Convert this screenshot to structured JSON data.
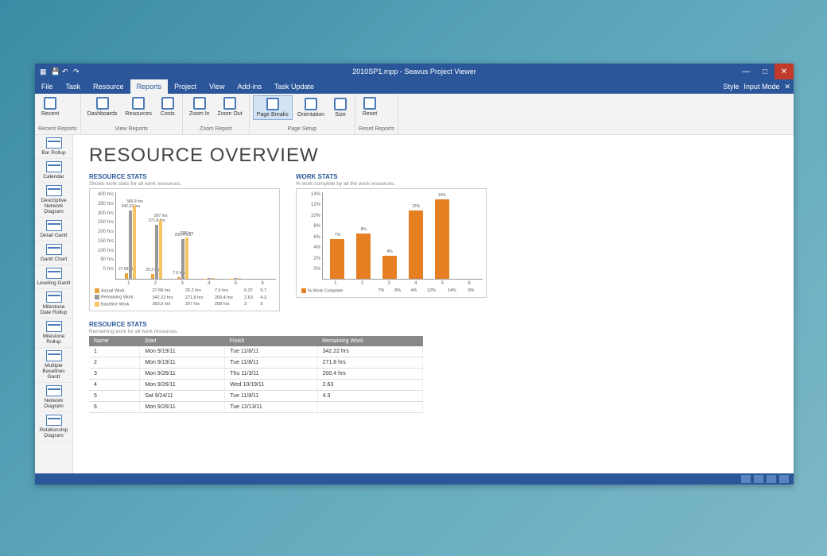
{
  "window": {
    "title": "2010SP1.mpp - Seavus Project Viewer"
  },
  "menu": {
    "items": [
      "File",
      "Task",
      "Resource",
      "Reports",
      "Project",
      "View",
      "Add-ins",
      "Task Update"
    ],
    "active": "Reports",
    "right": [
      "Style",
      "Input Mode"
    ]
  },
  "ribbon": {
    "groups": [
      {
        "name": "Recent Reports",
        "buttons": [
          {
            "label": "Recent",
            "icon": "doc"
          }
        ]
      },
      {
        "name": "View Reports",
        "buttons": [
          {
            "label": "Dashboards",
            "icon": "doc"
          },
          {
            "label": "Resources",
            "icon": "doc"
          },
          {
            "label": "Costs",
            "icon": "doc"
          }
        ]
      },
      {
        "name": "Zoom Report",
        "buttons": [
          {
            "label": "Zoom In",
            "icon": "doc"
          },
          {
            "label": "Zoom Out",
            "icon": "doc"
          }
        ]
      },
      {
        "name": "Page Setup",
        "buttons": [
          {
            "label": "Page Breaks",
            "icon": "doc",
            "selected": true
          },
          {
            "label": "Orientation",
            "icon": "doc"
          },
          {
            "label": "Size",
            "icon": "doc"
          }
        ]
      },
      {
        "name": "Reset Reports",
        "buttons": [
          {
            "label": "Reset",
            "icon": "doc"
          }
        ]
      }
    ]
  },
  "sidebar": {
    "items": [
      "Bar Rollup",
      "Calendar",
      "Descriptive Network Diagram",
      "Detail Gantt",
      "Gantt Chart",
      "Leveling Gantt",
      "Milestone Date Rollup",
      "Milestone Rollup",
      "Multiple Baselines Gantt",
      "Network Diagram",
      "Relationship Diagram"
    ]
  },
  "page": {
    "title": "RESOURCE OVERVIEW",
    "resource_stats": {
      "title": "RESOURCE STATS",
      "subtitle": "Shows work stats for all work resources.",
      "y_ticks": [
        "0 hrs",
        "50 hrs",
        "100 hrs",
        "150 hrs",
        "200 hrs",
        "250 hrs",
        "300 hrs",
        "350 hrs",
        "400 hrs"
      ],
      "legend": [
        {
          "name": "Actual Work",
          "sw": "sw-actual",
          "values": [
            "27.68 hrs",
            "25.2 hrs",
            "7.6 hrs",
            "0.37",
            "0.7",
            ""
          ]
        },
        {
          "name": "Remaining Work",
          "sw": "sw-rem",
          "values": [
            "342.22 hrs",
            "271.8 hrs",
            "200.4 hrs",
            "2.63",
            "4.3",
            ""
          ]
        },
        {
          "name": "Baseline Work",
          "sw": "sw-base",
          "values": [
            "369.9 hrs",
            "297 hrs",
            "208 hrs",
            "3",
            "5",
            ""
          ]
        }
      ],
      "categories": [
        "1",
        "2",
        "3",
        "4",
        "5",
        "6"
      ]
    },
    "work_stats": {
      "title": "WORK STATS",
      "subtitle": "% work complete by all the work resources.",
      "y_ticks": [
        "0%",
        "2%",
        "4%",
        "6%",
        "8%",
        "10%",
        "12%",
        "14%"
      ],
      "legend": {
        "name": "% Work Complete",
        "sw": "sw-orange",
        "values": [
          "7%",
          "8%",
          "4%",
          "12%",
          "14%",
          "0%"
        ]
      },
      "categories": [
        "1",
        "2",
        "3",
        "4",
        "5",
        "6"
      ]
    },
    "resource_table": {
      "title": "RESOURCE STATS",
      "subtitle": "Remaining work for all work resources.",
      "headers": [
        "Name",
        "Start",
        "Finish",
        "Remaining Work"
      ],
      "rows": [
        [
          "1",
          "Mon 9/19/11",
          "Tue 11/8/11",
          "342.22 hrs"
        ],
        [
          "2",
          "Mon 9/19/11",
          "Tue 11/8/11",
          "271.8 hrs"
        ],
        [
          "3",
          "Mon 9/26/11",
          "Thu 11/3/11",
          "200.4 hrs"
        ],
        [
          "4",
          "Mon 9/26/11",
          "Wed 10/19/11",
          "2.63"
        ],
        [
          "5",
          "Sat 9/24/11",
          "Tue 11/8/11",
          "4.3"
        ],
        [
          "6",
          "Mon 9/26/11",
          "Tue 12/13/11",
          ""
        ]
      ]
    }
  },
  "chart_data": [
    {
      "type": "bar",
      "title": "RESOURCE STATS",
      "categories": [
        "1",
        "2",
        "3",
        "4",
        "5",
        "6"
      ],
      "series": [
        {
          "name": "Actual Work",
          "values": [
            27.68,
            25.2,
            7.6,
            0.37,
            0.7,
            0
          ]
        },
        {
          "name": "Remaining Work",
          "values": [
            342.22,
            271.8,
            200.4,
            2.63,
            4.3,
            0
          ]
        },
        {
          "name": "Baseline Work",
          "values": [
            369.9,
            297,
            208,
            3,
            5,
            0
          ]
        }
      ],
      "ylabel": "hrs",
      "ylim": [
        0,
        400
      ]
    },
    {
      "type": "bar",
      "title": "WORK STATS",
      "categories": [
        "1",
        "2",
        "3",
        "4",
        "5",
        "6"
      ],
      "series": [
        {
          "name": "% Work Complete",
          "values": [
            7,
            8,
            4,
            12,
            14,
            0
          ]
        }
      ],
      "ylabel": "%",
      "ylim": [
        0,
        14
      ]
    }
  ]
}
